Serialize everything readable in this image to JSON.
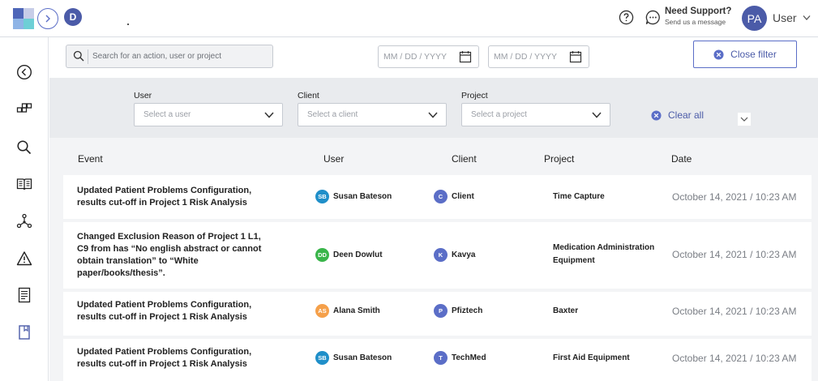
{
  "header": {
    "workspace_initial": "D",
    "support_title": "Need Support?",
    "support_subtitle": "Send us a message",
    "user_initials": "PA",
    "user_name": "User",
    "colors": {
      "accent": "#4b5ba8",
      "logo": [
        "#4e66b8",
        "#8fb4e6",
        "#6ecfd6",
        "#c7cde8"
      ]
    }
  },
  "sidebar": {
    "items": [
      "back-circle-icon",
      "modules-icon",
      "search-icon",
      "book-icon",
      "network-icon",
      "warning-icon",
      "document-list-icon",
      "bookmark-icon"
    ]
  },
  "toolbar": {
    "search_placeholder": "Search for an action, user or project",
    "date_from_placeholder": "MM / DD / YYYY",
    "date_to_placeholder": "MM / DD / YYYY",
    "close_filter_label": "Close filter"
  },
  "filters": {
    "user_label": "User",
    "user_placeholder": "Select a user",
    "client_label": "Client",
    "client_placeholder": "Select a client",
    "project_label": "Project",
    "project_placeholder": "Select a project",
    "clear_all_label": "Clear all"
  },
  "table": {
    "columns": [
      "Event",
      "User",
      "Client",
      "Project",
      "Date"
    ],
    "rows": [
      {
        "event": "Updated Patient Problems Configuration, results cut-off in Project 1 Risk Analysis",
        "user_initials": "SB",
        "user": "Susan Bateson",
        "user_color": "#1f8fc9",
        "client_initial": "C",
        "client": "Client",
        "project": "Time Capture",
        "date": "October 14, 2021 / 10:23 AM"
      },
      {
        "event": "Changed Exclusion Reason of Project 1 L1, C9 from has “No english abstract or cannot obtain translation” to “White paper/books/thesis”.",
        "user_initials": "DD",
        "user": "Deen Dowlut",
        "user_color": "#39b54a",
        "client_initial": "K",
        "client": "Kavya",
        "project": "Medication Administration Equipment",
        "date": "October 14, 2021 / 10:23 AM"
      },
      {
        "event": "Updated Patient Problems Configuration, results cut-off in Project 1 Risk Analysis",
        "user_initials": "AS",
        "user": "Alana Smith",
        "user_color": "#f5a04a",
        "client_initial": "P",
        "client": "Pfiztech",
        "project": "Baxter",
        "date": "October 14, 2021 / 10:23 AM"
      },
      {
        "event": "Updated Patient Problems Configuration, results cut-off in Project 1 Risk Analysis",
        "user_initials": "SB",
        "user": "Susan Bateson",
        "user_color": "#1f8fc9",
        "client_initial": "T",
        "client": "TechMed",
        "project": "First Aid Equipment",
        "date": "October 14, 2021 / 10:23 AM"
      }
    ],
    "client_avatar_color": "#5b6ec7"
  }
}
